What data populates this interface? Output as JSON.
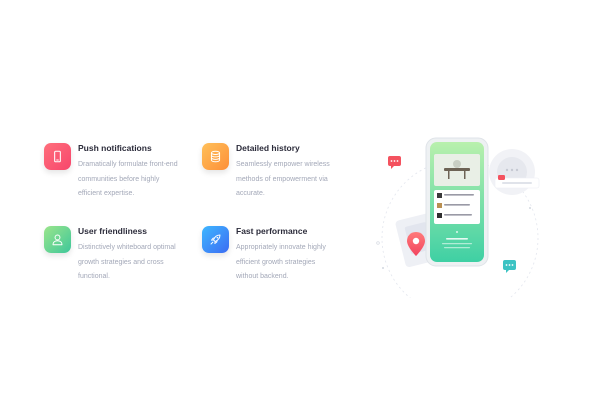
{
  "features": [
    {
      "title": "Push notifications",
      "description": "Dramatically formulate front-end communities before highly efficient expertise.",
      "icon": "phone-icon"
    },
    {
      "title": "Detailed history",
      "description": "Seamlessly empower wireless methods of empowerment via accurate.",
      "icon": "database-icon"
    },
    {
      "title": "User friendliness",
      "description": "Distinctively whiteboard optimal growth strategies and cross functional.",
      "icon": "user-icon"
    },
    {
      "title": "Fast performance",
      "description": "Appropriately innovate highly efficient growth strategies without backend.",
      "icon": "rocket-icon"
    }
  ],
  "colors": {
    "heading": "#2b2b3a",
    "body_text": "#a3a8b8",
    "tile_red": "#f7466c",
    "tile_orange": "#fd8f38",
    "tile_green": "#3ec79a",
    "tile_blue": "#3c6cf3",
    "phone_screen": "#6fdc9f"
  }
}
